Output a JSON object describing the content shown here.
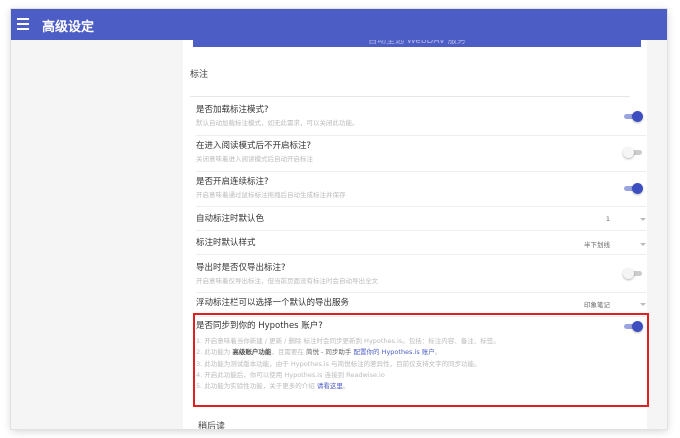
{
  "app": {
    "title": "高级设定"
  },
  "top_button": {
    "label": "自动全选 WebDAV 服务"
  },
  "section": {
    "title": "标注"
  },
  "settings": [
    {
      "title": "是否加载标注模式?",
      "desc": "默认自动加载标注模式，如无此需求，可以关闭此功能。",
      "state": "on"
    },
    {
      "title": "在进入阅读模式后不开启标注?",
      "desc": "关闭意味着进入阅读模式后自动开启标注",
      "state": "off"
    },
    {
      "title": "是否开启连续标注?",
      "desc": "开启意味着通过鼠标标注拖拽后自动生成标注并保存",
      "state": "on"
    },
    {
      "title": "自动标注时默认色",
      "value": "1"
    },
    {
      "title": "标注时默认样式",
      "value": "半下划线"
    },
    {
      "title": "导出时是否仅导出标注?",
      "desc": "开启意味着仅导出标注，但当前页面没有标注时会自动导出全文",
      "state": "off"
    },
    {
      "title": "浮动标注栏可以选择一个默认的导出服务",
      "value": "印象笔记"
    }
  ],
  "hypothes": {
    "title": "是否同步到你的 Hypothes 账户?",
    "state": "on",
    "lines": [
      {
        "n": "1.",
        "a": "开启意味着当你新建 / 更新 / 删除 标注时会同步更新到 Hypothes.is。包括：标注内容、备注、标签。"
      },
      {
        "n": "2.",
        "a": "此功能为 ",
        "b": "高级账户功能",
        "c": "，且需要在 ",
        "d": "简悦 - 同步助手",
        "e": " 配置你的 Hypothes.is 账户",
        "f": "。"
      },
      {
        "n": "3.",
        "a": "此功能为测试版本功能，由于 Hypothes.is 与简悦标注的差异性，目前仅支持文字的同步功能。"
      },
      {
        "n": "4.",
        "a": "开启此功能后，你可以使用 Hypothes.is 连接到 Readwise.io"
      },
      {
        "n": "5.",
        "a": "此功能为实验性功能，关于更多的介绍 ",
        "b": "请看这里",
        "c": "。"
      }
    ]
  },
  "next_section": {
    "title": "稍后读"
  },
  "colors": {
    "accent": "#4d5dc6",
    "highlight": "#e02020"
  }
}
